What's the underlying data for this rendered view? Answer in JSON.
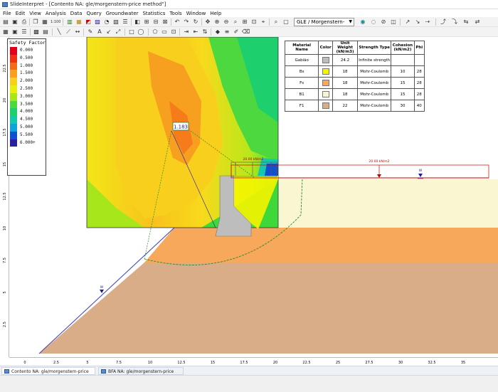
{
  "window": {
    "title": "SlideInterpret - [Contento NA: gle/morgenstern-price method\"]"
  },
  "menu": [
    "File",
    "Edit",
    "View",
    "Analysis",
    "Data",
    "Query",
    "Groundwater",
    "Statistics",
    "Tools",
    "Window",
    "Help"
  ],
  "toolbar": {
    "method_select": "GLE / Morgenstern-Price",
    "zoom_label": "1:100"
  },
  "legend": {
    "title": "Safety Factor",
    "items": [
      {
        "label": "0.000",
        "color": "#e0001a"
      },
      {
        "label": "0.500",
        "color": "#f02f14"
      },
      {
        "label": "1.000",
        "color": "#f36b1a"
      },
      {
        "label": "1.500",
        "color": "#f7a020"
      },
      {
        "label": "2.000",
        "color": "#f9cf1e"
      },
      {
        "label": "2.500",
        "color": "#e6ee12"
      },
      {
        "label": "3.000",
        "color": "#a6e61b"
      },
      {
        "label": "3.500",
        "color": "#4cd83e"
      },
      {
        "label": "4.000",
        "color": "#1ecf6e"
      },
      {
        "label": "4.500",
        "color": "#14c8ae"
      },
      {
        "label": "5.000",
        "color": "#0fa3d8"
      },
      {
        "label": "5.500",
        "color": "#1050d0"
      },
      {
        "label": "6.000+",
        "color": "#2a1f9f"
      }
    ]
  },
  "materials_table": {
    "headers": [
      "Material Name",
      "Color",
      "Unit Weight (kN/m3)",
      "Strength Type",
      "Cohesion (kN/m2)",
      "Phi"
    ],
    "rows": [
      {
        "name": "Gabião",
        "color": "#bdbdbd",
        "unit_weight": "24.2",
        "strength": "Infinite strength",
        "cohesion": "",
        "phi": ""
      },
      {
        "name": "Bs",
        "color": "#f5f500",
        "unit_weight": "18",
        "strength": "Mohr-Coulomb",
        "cohesion": "10",
        "phi": "28"
      },
      {
        "name": "Fs",
        "color": "#f8a85a",
        "unit_weight": "18",
        "strength": "Mohr-Coulomb",
        "cohesion": "15",
        "phi": "28"
      },
      {
        "name": "B1",
        "color": "#fbf6d2",
        "unit_weight": "18",
        "strength": "Mohr-Coulomb",
        "cohesion": "15",
        "phi": "28"
      },
      {
        "name": "F1",
        "color": "#d9ad87",
        "unit_weight": "22",
        "strength": "Mohr-Coulomb",
        "cohesion": "30",
        "phi": "40"
      }
    ]
  },
  "model": {
    "min_fs": "1.183",
    "load_label_small": "20.00 kN/m2",
    "load_label_large": "20.00 kN/m2",
    "water_marker": "W"
  },
  "ruler_x": [
    "0",
    "2.5",
    "5",
    "7.5",
    "10",
    "12.5",
    "15",
    "17.5",
    "20",
    "22.5",
    "25",
    "27.5",
    "30",
    "32.5",
    "35"
  ],
  "ruler_y": [
    "22.5",
    "20",
    "17.5",
    "15",
    "12.5",
    "10",
    "7.5",
    "5",
    "2.5"
  ],
  "doc_tabs": [
    "Contento NA: gle/morgenstern-price method\"",
    "BFA NA: gle/morgenstern-price method\""
  ]
}
